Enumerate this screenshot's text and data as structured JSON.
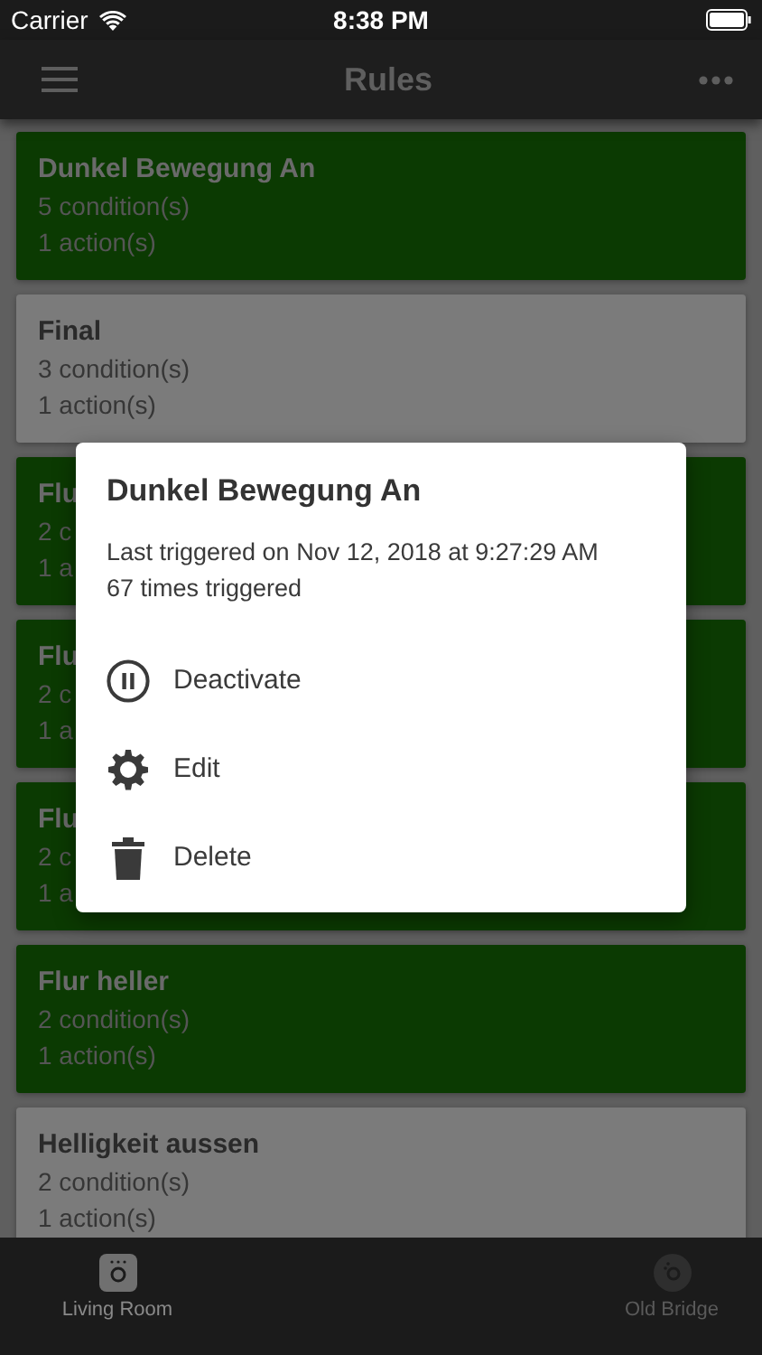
{
  "status_bar": {
    "carrier": "Carrier",
    "time": "8:38 PM"
  },
  "nav_bar": {
    "title": "Rules"
  },
  "rules": [
    {
      "name": "Dunkel Bewegung An",
      "conditions": "5 condition(s)",
      "actions": "1 action(s)",
      "active": true
    },
    {
      "name": "Final",
      "conditions": "3 condition(s)",
      "actions": "1 action(s)",
      "active": false
    },
    {
      "name": "Flu",
      "conditions": "2 c",
      "actions": "1 a",
      "active": true
    },
    {
      "name": "Flu",
      "conditions": "2 c",
      "actions": "1 a",
      "active": true
    },
    {
      "name": "Flu",
      "conditions": "2 c",
      "actions": "1 a",
      "active": true
    },
    {
      "name": "Flur heller",
      "conditions": "2 condition(s)",
      "actions": "1 action(s)",
      "active": true
    },
    {
      "name": "Helligkeit aussen",
      "conditions": "2 condition(s)",
      "actions": "1 action(s)",
      "active": false
    }
  ],
  "dialog": {
    "title": "Dunkel Bewegung An",
    "details": [
      "Last triggered on Nov 12, 2018 at 9:27:29 AM",
      "67 times triggered"
    ],
    "actions": [
      {
        "kind": "pause",
        "label": "Deactivate"
      },
      {
        "kind": "gear",
        "label": "Edit"
      },
      {
        "kind": "trash",
        "label": "Delete"
      }
    ]
  },
  "tab_bar": [
    {
      "kind": "room",
      "label": "Living Room",
      "selected": true
    },
    {
      "kind": "bridge",
      "label": "Old Bridge",
      "selected": false
    }
  ]
}
